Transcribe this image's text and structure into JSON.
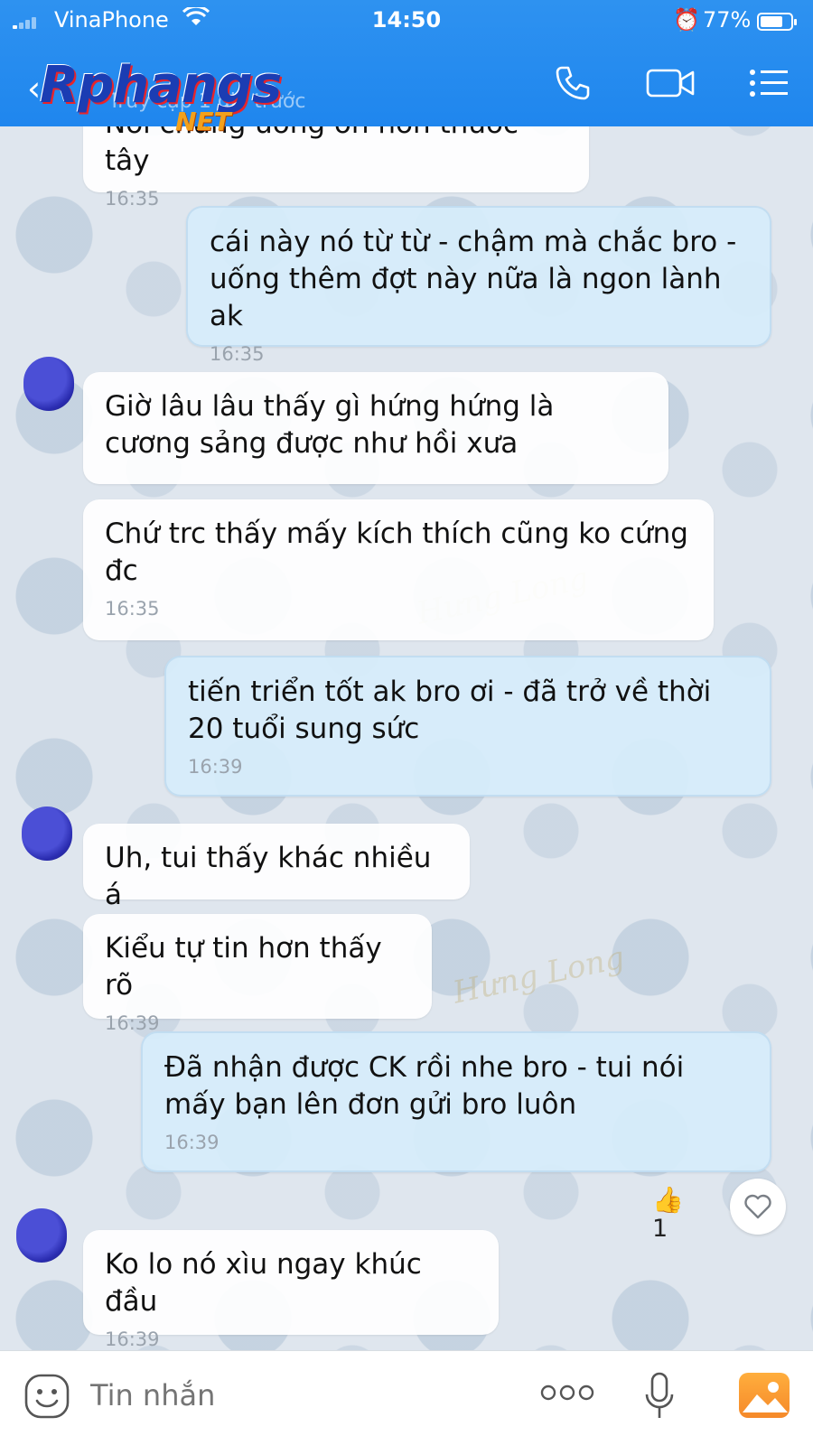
{
  "status_bar": {
    "carrier": "VinaPhone",
    "time": "14:50",
    "battery": "77%"
  },
  "header": {
    "logo_main": "Rphangs",
    "logo_sub": "NET",
    "last_seen": "Truy cập 1 giờ trước",
    "icons": [
      "back-icon",
      "phone-icon",
      "video-call-icon",
      "menu-icon"
    ]
  },
  "watermark": "Hưng Long",
  "messages": [
    {
      "id": "m1",
      "side": "in",
      "text": "Nói chung uống ổn hơn thuốc tây",
      "time": "16:35"
    },
    {
      "id": "m2",
      "side": "out",
      "text": "cái này nó từ từ - chậm mà chắc bro - uống thêm đợt này nữa là ngon lành ak",
      "time": "16:35"
    },
    {
      "id": "m3",
      "side": "in",
      "text": "Giờ lâu lâu thấy gì hứng hứng là cương sảng được như hồi xưa",
      "time": ""
    },
    {
      "id": "m4",
      "side": "in",
      "text": "Chứ trc thấy mấy kích thích cũng ko cứng đc",
      "time": "16:35"
    },
    {
      "id": "m5",
      "side": "out",
      "text": "tiến triển tốt ak bro ơi - đã trở về thời 20 tuổi sung sức",
      "time": "16:39"
    },
    {
      "id": "m6",
      "side": "in",
      "text": "Uh, tui thấy khác nhiều á",
      "time": ""
    },
    {
      "id": "m7",
      "side": "in",
      "text": "Kiểu tự tin hơn thấy rõ",
      "time": "16:39"
    },
    {
      "id": "m8",
      "side": "out",
      "text": "Đã nhận được CK rồi nhe bro - tui nói mấy bạn lên đơn gửi bro luôn",
      "time": "16:39"
    },
    {
      "id": "m9",
      "side": "in",
      "text": "Ko lo nó xìu ngay khúc đầu",
      "time": "16:39"
    }
  ],
  "reaction": {
    "emoji": "thumbs-up-icon",
    "count": "1"
  },
  "input_bar": {
    "placeholder": "Tin nhắn",
    "icons": [
      "emoji-icon",
      "more-icon",
      "microphone-icon",
      "image-icon"
    ]
  },
  "colors": {
    "header_blue": "#2188ee",
    "incoming_bubble": "#ffffff",
    "outgoing_bubble": "#d6ecfa",
    "timestamp": "#9aa3ad",
    "avatar_blue": "#3436c4"
  }
}
